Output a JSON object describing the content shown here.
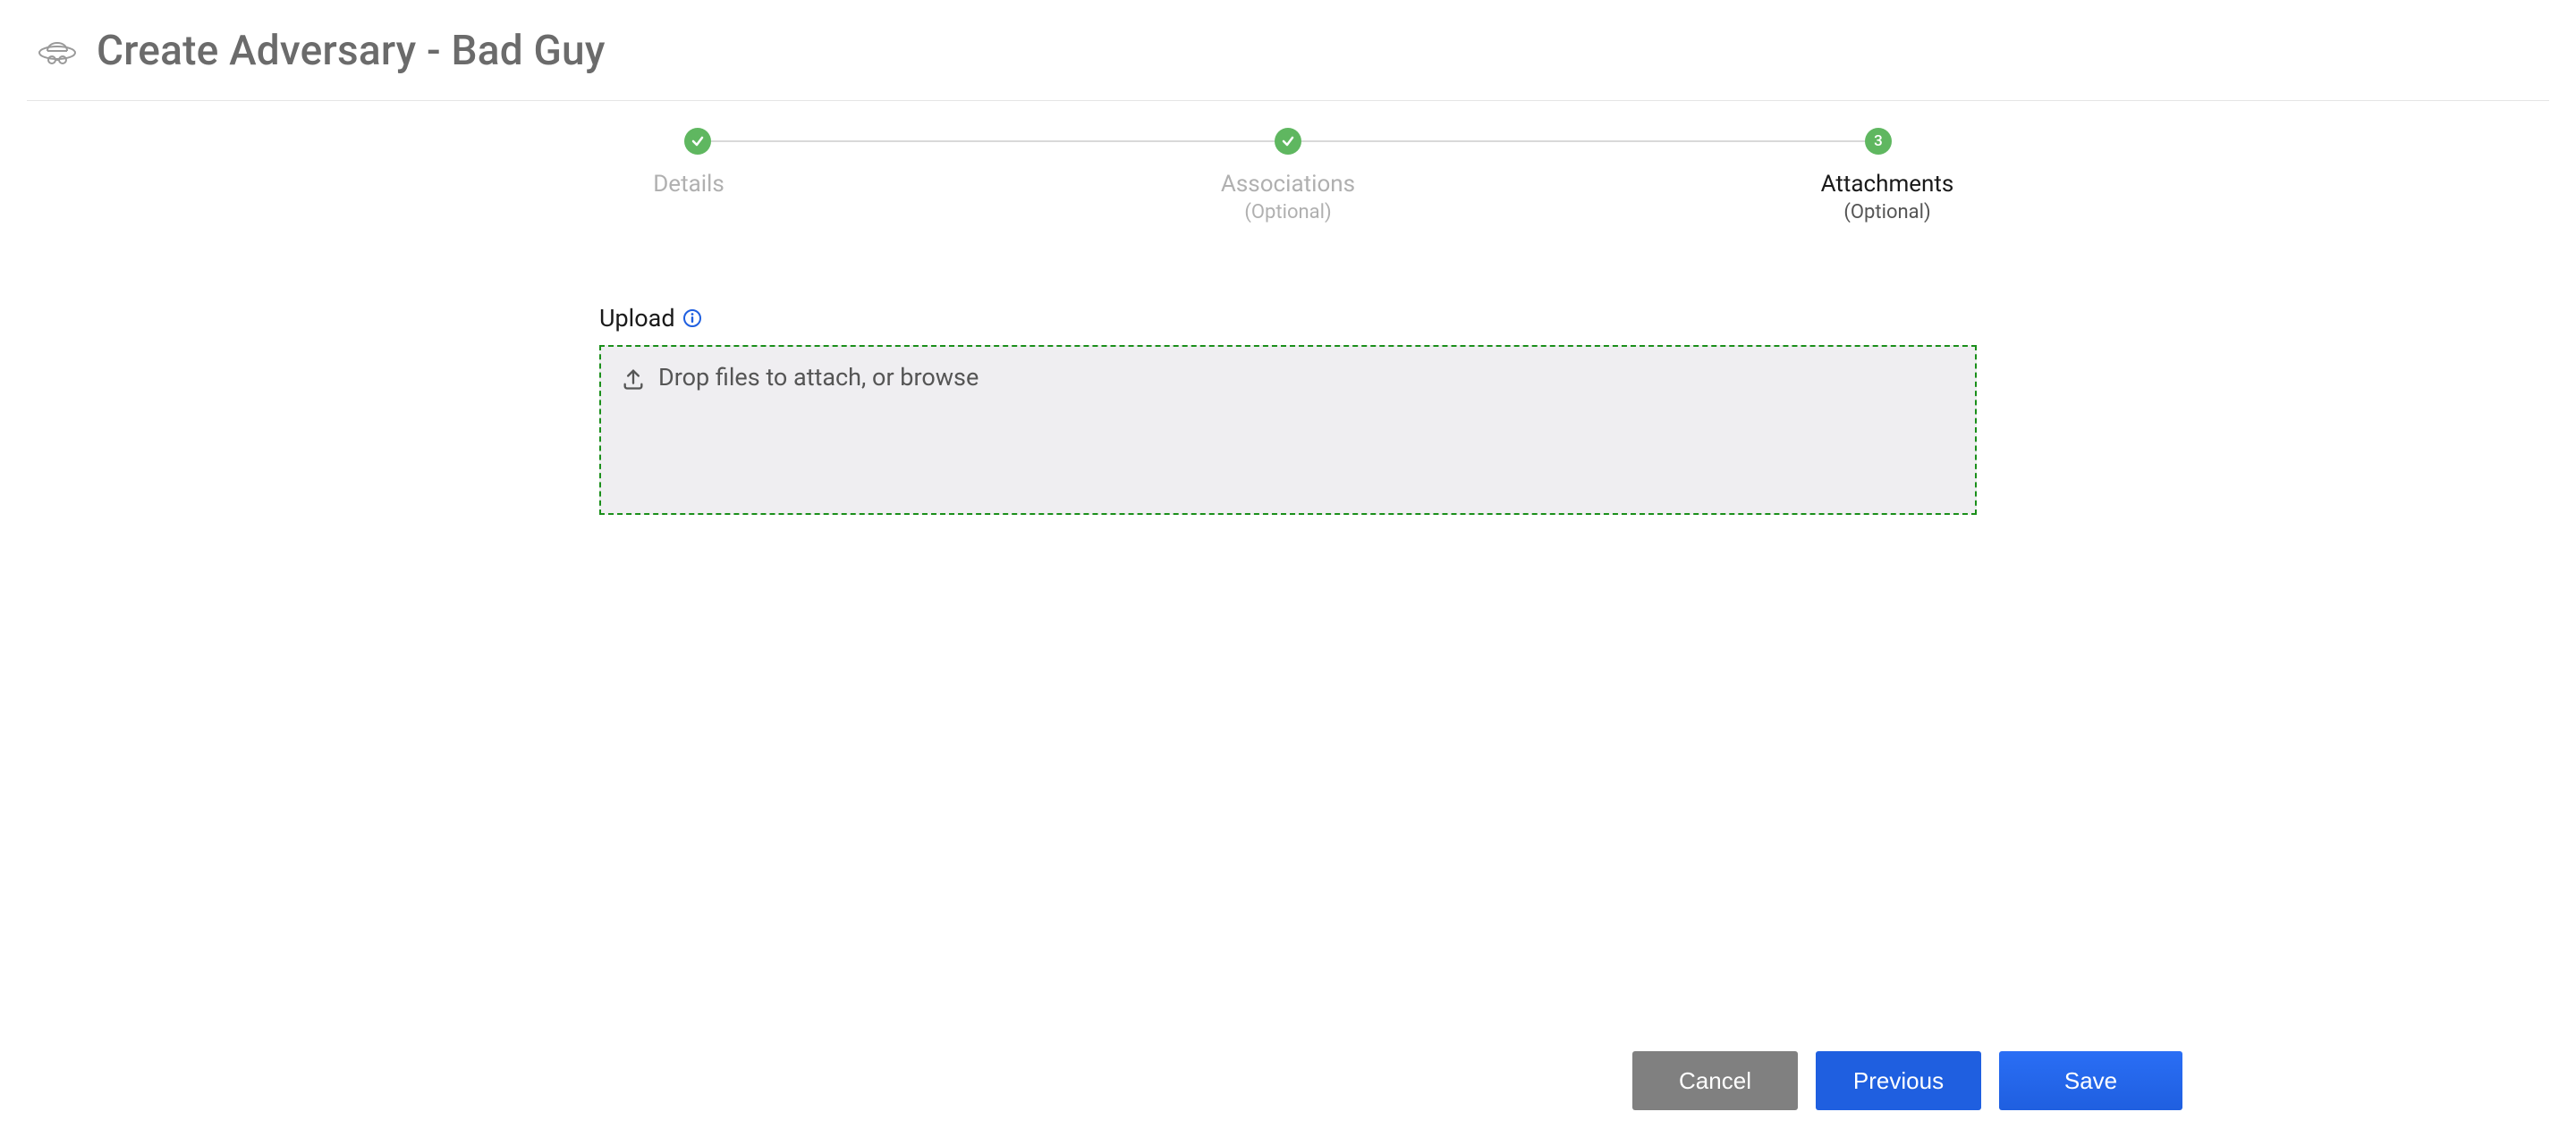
{
  "header": {
    "title": "Create Adversary - Bad Guy"
  },
  "stepper": {
    "steps": [
      {
        "label": "Details",
        "sublabel": "",
        "badge": "✔",
        "active": false
      },
      {
        "label": "Associations",
        "sublabel": "(Optional)",
        "badge": "✔",
        "active": false
      },
      {
        "label": "Attachments",
        "sublabel": "(Optional)",
        "badge": "3",
        "active": true
      }
    ]
  },
  "upload": {
    "label": "Upload",
    "dropzone_text": "Drop files to attach, or browse"
  },
  "footer": {
    "cancel": "Cancel",
    "previous": "Previous",
    "save": "Save"
  },
  "colors": {
    "step_green": "#5fb760",
    "dropzone_border": "#1a8f1a",
    "primary_blue": "#1f5fe0"
  }
}
